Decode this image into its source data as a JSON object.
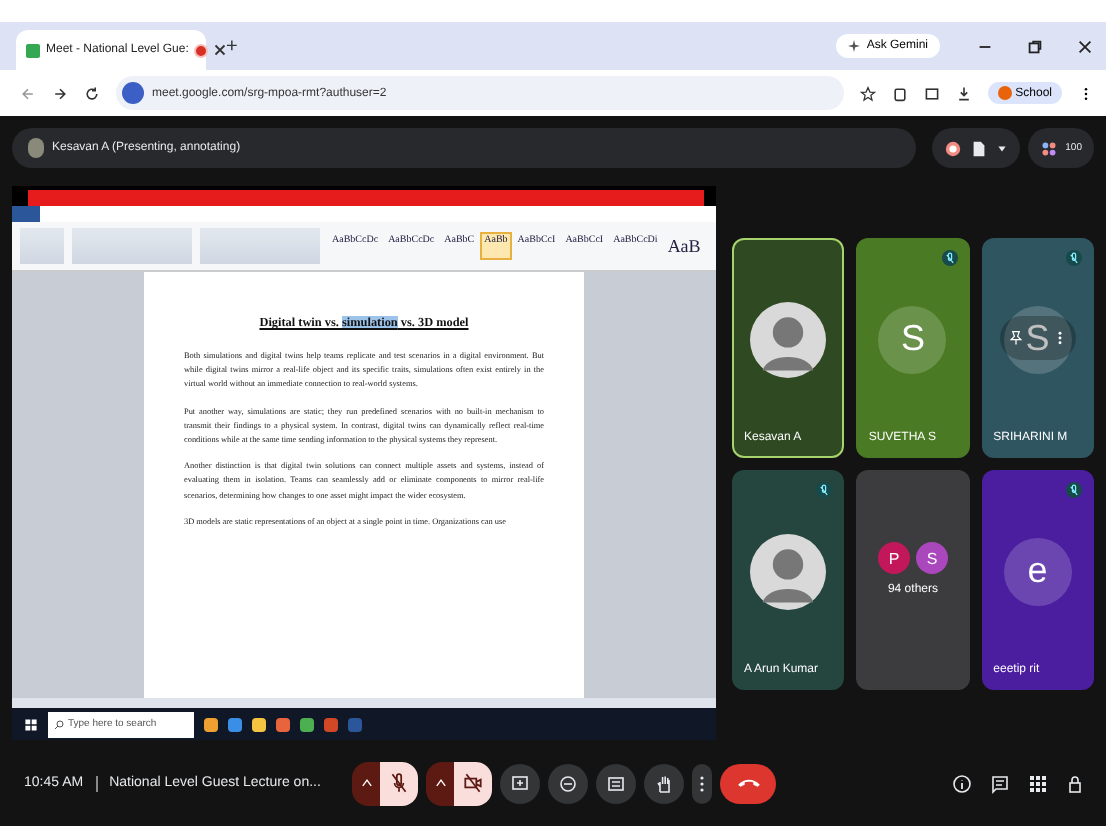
{
  "browser": {
    "tab": {
      "title": "Meet - National Level Gue:",
      "recording": true
    },
    "new_tab": "+",
    "ask_gemini": "Ask Gemini",
    "url": "meet.google.com/srg-mpoa-rmt?authuser=2",
    "profile": "School"
  },
  "meeting_header": {
    "presenter": "Kesavan A (Presenting, annotating)",
    "participant_count": "100"
  },
  "shared_screen": {
    "word": {
      "styles": [
        {
          "sample": "AaBbCcDc",
          "selected": false
        },
        {
          "sample": "AaBbCcDc",
          "selected": false
        },
        {
          "sample": "AaBbC",
          "selected": false
        },
        {
          "sample": "AaBb",
          "selected": true
        },
        {
          "sample": "AaBbCcI",
          "selected": false
        },
        {
          "sample": "AaBbCcI",
          "selected": false
        },
        {
          "sample": "AaBbCcDi",
          "selected": false
        },
        {
          "sample": "AaB",
          "selected": false
        }
      ],
      "title": [
        {
          "text": "Digital twin vs. ",
          "selected": false
        },
        {
          "text": "simulation",
          "selected": true
        },
        {
          "text": " vs. 3D model",
          "selected": false
        }
      ],
      "paragraphs": [
        "Both simulations and digital twins help teams replicate and test scenarios in a digital environment. But while digital twins mirror a real-life object and its specific traits, simulations often exist entirely in the virtual world without an immediate connection to real-world systems.",
        "Put another way, simulations are static; they run predefined scenarios with no built-in mechanism to transmit their findings to a physical system. In contrast, digital twins can dynamically reflect real-time conditions while at the same time sending information to the physical systems they represent.",
        "Another distinction is that digital twin solutions can connect multiple assets and systems, instead of evaluating them in isolation. Teams can seamlessly add or eliminate components to mirror real-life scenarios, determining how changes to one asset might impact the wider ecosystem.",
        "3D models are static representations of an object at a single point in time. Organizations can use"
      ]
    },
    "search_placeholder": "Type here to search"
  },
  "participants": [
    {
      "kind": "photo",
      "name": "Kesavan A",
      "speaking": true,
      "muted": false,
      "color": "#2f4a22"
    },
    {
      "kind": "initial",
      "name": "SUVETHA S",
      "initial": "S",
      "speaking": false,
      "muted": true,
      "color": "#4a7a24"
    },
    {
      "kind": "initial",
      "name": "SRIHARINI M",
      "initial": "S",
      "speaking": false,
      "muted": true,
      "hovered": true,
      "color": "#2f5560"
    },
    {
      "kind": "photo",
      "name": "A Arun Kumar",
      "speaking": false,
      "muted": true,
      "color": "#25453f"
    },
    {
      "kind": "others",
      "name": "94 others",
      "initials": [
        {
          "text": "P",
          "color": "#c2185b"
        },
        {
          "text": "S",
          "color": "#ab47bc"
        }
      ],
      "speaking": false,
      "muted": false,
      "color": "#3c3c3e"
    },
    {
      "kind": "initial",
      "name": "eeetip rit",
      "initial": "e",
      "speaking": false,
      "muted": true,
      "color": "#4b1ea0"
    }
  ],
  "bottom_bar": {
    "time": "10:45 AM",
    "meeting_title": "National Level Guest Lecture on...",
    "mic_on": false,
    "camera_on": false
  }
}
